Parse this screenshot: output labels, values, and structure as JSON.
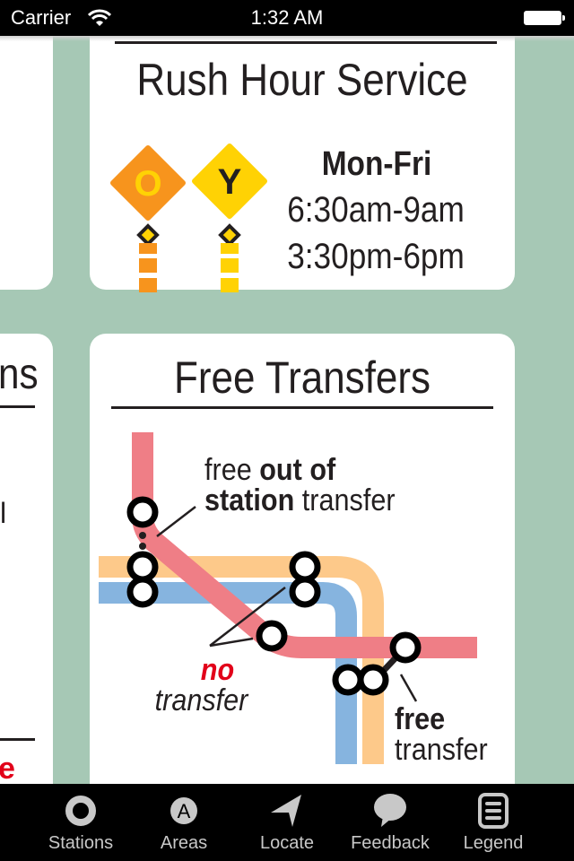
{
  "status_bar": {
    "carrier": "Carrier",
    "time": "1:32 AM",
    "wifi_icon": "wifi-icon",
    "battery_icon": "battery-icon"
  },
  "colors": {
    "map_background": "#a6c8b5",
    "orange_line": "#f7941d",
    "yellow_line": "#ffd204",
    "red_line": "#ef7e86",
    "blue_line": "#86b4df",
    "light_orange_line": "#fdc98a",
    "no_red": "#e2001a"
  },
  "left_card": {
    "title_fragment": "ns",
    "text_fragment": "l",
    "red_fragment": "e"
  },
  "rush_hour": {
    "title": "Rush Hour Service",
    "badges": [
      {
        "letter": "O",
        "line": "orange"
      },
      {
        "letter": "Y",
        "line": "yellow"
      }
    ],
    "days": "Mon-Fri",
    "times": [
      "6:30am-9am",
      "3:30pm-6pm"
    ]
  },
  "free_transfers": {
    "title": "Free Transfers",
    "out_of_station": {
      "pre": "free ",
      "bold1": "out of",
      "bold2": "station",
      "post": " transfer"
    },
    "no_transfer": {
      "no": "no",
      "rest": "transfer"
    },
    "free_transfer": {
      "bold": "free",
      "rest": "transfer"
    }
  },
  "tab_bar": {
    "items": [
      {
        "label": "Stations",
        "icon": "station-ring-icon"
      },
      {
        "label": "Areas",
        "icon": "area-a-icon",
        "glyph": "A"
      },
      {
        "label": "Locate",
        "icon": "locate-arrow-icon"
      },
      {
        "label": "Feedback",
        "icon": "speech-bubble-icon"
      },
      {
        "label": "Legend",
        "icon": "legend-list-icon"
      }
    ]
  }
}
